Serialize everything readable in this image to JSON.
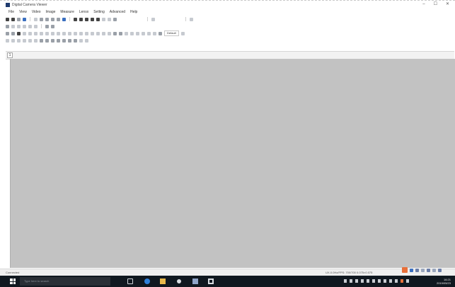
{
  "window": {
    "title": "Digital Camera Viewer",
    "controls": [
      "–",
      "☐",
      "✕"
    ]
  },
  "menu": [
    "File",
    "View",
    "Video",
    "Image",
    "Measure",
    "Lensx",
    "Setting",
    "Advanced",
    "Help"
  ],
  "toolbar_row3": {
    "zoom_value": "Default"
  },
  "tab": {
    "label": "1"
  },
  "status": {
    "left": "Connected",
    "right": "UX-0.0Hz/FPS: 700/700    0.075×0.075"
  },
  "taskbar": {
    "search_placeholder": "Type here to search",
    "clock_time": "16:21",
    "clock_date": "2019/05/23"
  },
  "colors": {
    "workspace": "#c2c2c2",
    "taskbar": "#101820",
    "accent": "#3a6fc0",
    "notification_orange": "#e8703a"
  }
}
